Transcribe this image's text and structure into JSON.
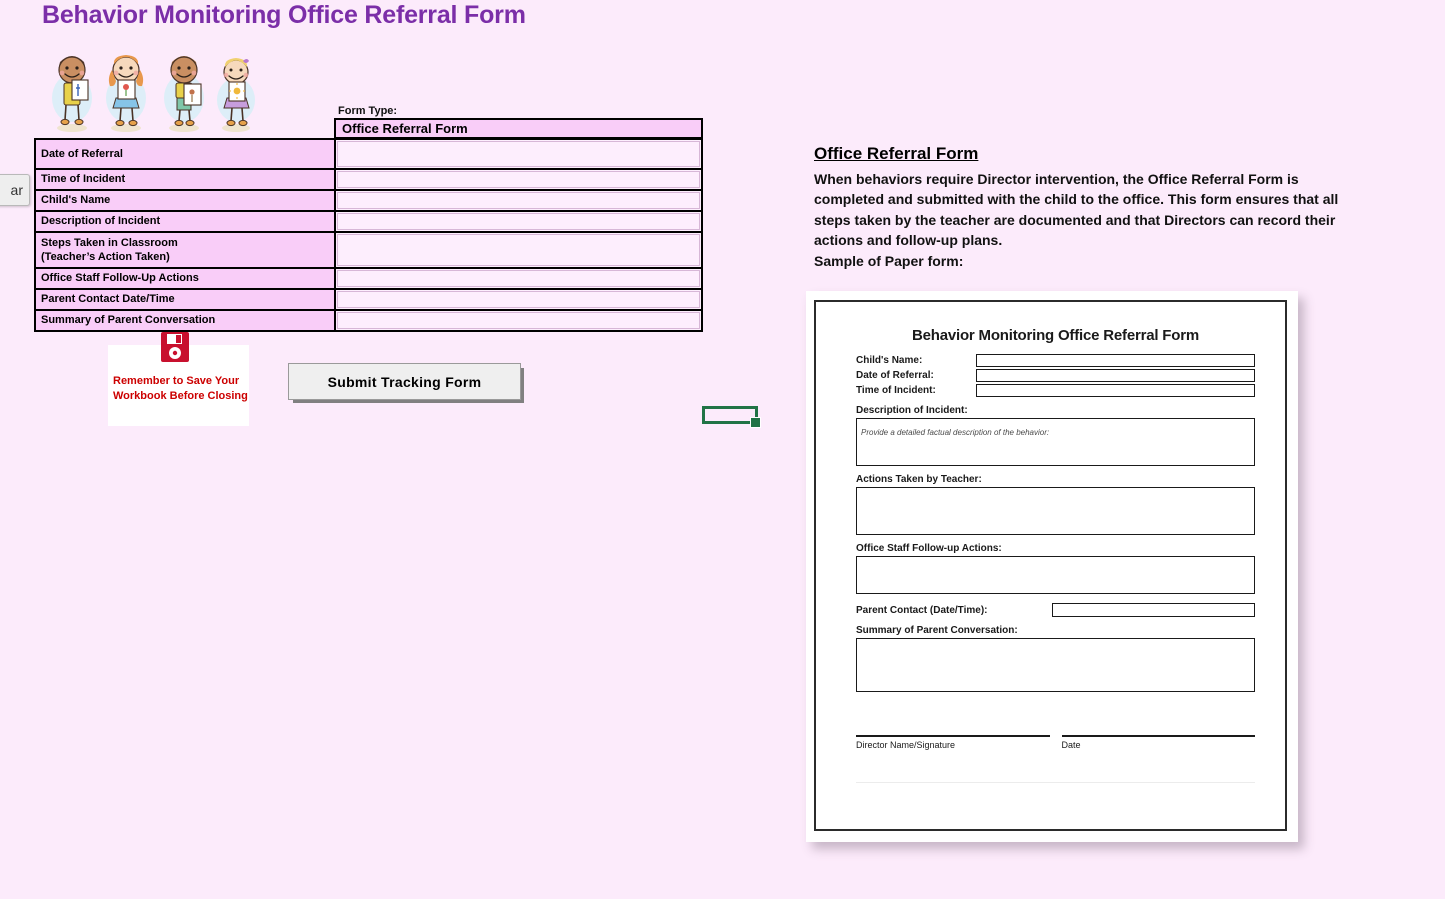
{
  "page": {
    "title": "Behavior Monitoring Office Referral Form",
    "background_color": "#fcebfb",
    "title_color": "#7b2ea8"
  },
  "clipart": {
    "name": "four-children-holding-drawings"
  },
  "left_cut_button": {
    "label": "ar"
  },
  "form_type": {
    "label": "Form Type:",
    "value": "Office Referral Form"
  },
  "entry_grid": {
    "rows": [
      {
        "label": "Date of Referral",
        "value": "",
        "size": "tall"
      },
      {
        "label": "Time of Incident",
        "value": "",
        "size": "short"
      },
      {
        "label": "Child's Name",
        "value": "",
        "size": "short"
      },
      {
        "label": "Description of Incident",
        "value": "",
        "size": "short"
      },
      {
        "label": "Steps Taken in Classroom",
        "label2": "(Teacher’s Action Taken)",
        "value": "",
        "size": "double"
      },
      {
        "label": "Office Staff Follow-Up Actions",
        "value": "",
        "size": "short"
      },
      {
        "label": "Parent Contact Date/Time",
        "value": "",
        "size": "short"
      },
      {
        "label": "Summary of Parent Conversation",
        "value": "",
        "size": "short"
      }
    ]
  },
  "save_reminder": {
    "icon": "floppy-disk-icon",
    "line1": "Remember to Save Your",
    "line2": "Workbook Before Closing",
    "color": "#cc0000"
  },
  "submit_button": {
    "label": "Submit Tracking Form"
  },
  "cell_selection": {
    "color": "#217346"
  },
  "info_panel": {
    "heading": "Office Referral Form",
    "body": "When behaviors require Director intervention, the Office Referral Form is completed and submitted with the child to the office. This form ensures that all steps taken by the teacher are documented and that Directors can record their actions and follow-up plans.",
    "sample_label": "Sample of Paper form:"
  },
  "paper_form": {
    "title": "Behavior Monitoring Office Referral Form",
    "inline_fields": [
      {
        "label": "Child's Name:",
        "value": ""
      },
      {
        "label": "Date of Referral:",
        "value": ""
      },
      {
        "label": "Time of Incident:",
        "value": ""
      }
    ],
    "description_label": "Description of Incident:",
    "description_placeholder": "Provide a detailed factual description of the behavior:",
    "actions_label": "Actions Taken by Teacher:",
    "followup_label": "Office Staff Follow-up Actions:",
    "parent_contact_label": "Parent Contact (Date/Time):",
    "summary_label": "Summary of Parent Conversation:",
    "signature_caption": "Director Name/Signature",
    "date_caption": "Date"
  }
}
